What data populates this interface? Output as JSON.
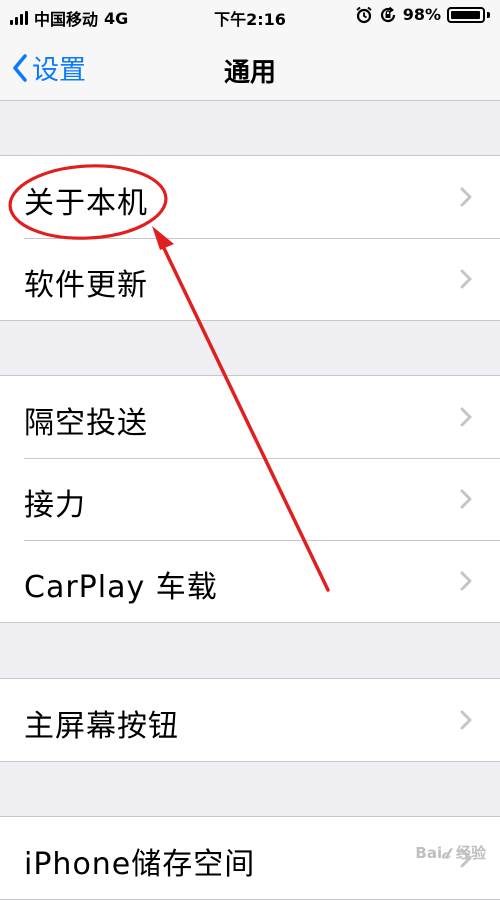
{
  "status_bar": {
    "carrier": "中国移动",
    "network": "4G",
    "time": "下午2:16",
    "battery_percent": "98%",
    "battery_level": 0.98
  },
  "nav": {
    "back_label": "设置",
    "title": "通用",
    "accent_color": "#0a7aff"
  },
  "groups": [
    {
      "items": [
        "关于本机",
        "软件更新"
      ]
    },
    {
      "items": [
        "隔空投送",
        "接力",
        "CarPlay 车载"
      ]
    },
    {
      "items": [
        "主屏幕按钮"
      ]
    },
    {
      "items": [
        "iPhone储存空间"
      ]
    }
  ],
  "annotation": {
    "color": "#e02020",
    "highlight_target": "关于本机"
  }
}
